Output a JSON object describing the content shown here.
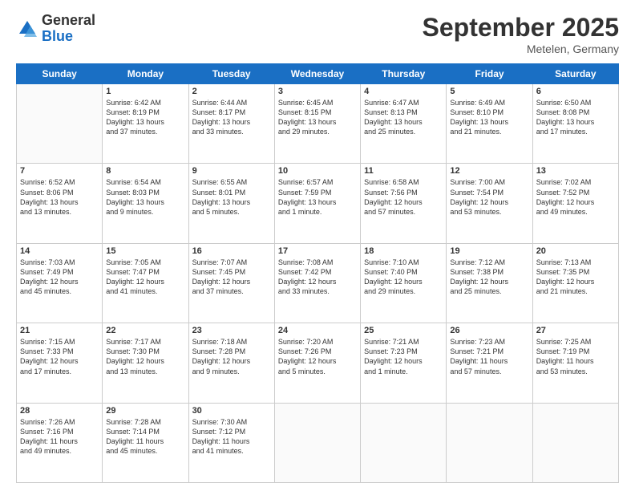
{
  "header": {
    "logo_general": "General",
    "logo_blue": "Blue",
    "month_title": "September 2025",
    "location": "Metelen, Germany"
  },
  "days_of_week": [
    "Sunday",
    "Monday",
    "Tuesday",
    "Wednesday",
    "Thursday",
    "Friday",
    "Saturday"
  ],
  "weeks": [
    [
      {
        "day": "",
        "info": ""
      },
      {
        "day": "1",
        "info": "Sunrise: 6:42 AM\nSunset: 8:19 PM\nDaylight: 13 hours\nand 37 minutes."
      },
      {
        "day": "2",
        "info": "Sunrise: 6:44 AM\nSunset: 8:17 PM\nDaylight: 13 hours\nand 33 minutes."
      },
      {
        "day": "3",
        "info": "Sunrise: 6:45 AM\nSunset: 8:15 PM\nDaylight: 13 hours\nand 29 minutes."
      },
      {
        "day": "4",
        "info": "Sunrise: 6:47 AM\nSunset: 8:13 PM\nDaylight: 13 hours\nand 25 minutes."
      },
      {
        "day": "5",
        "info": "Sunrise: 6:49 AM\nSunset: 8:10 PM\nDaylight: 13 hours\nand 21 minutes."
      },
      {
        "day": "6",
        "info": "Sunrise: 6:50 AM\nSunset: 8:08 PM\nDaylight: 13 hours\nand 17 minutes."
      }
    ],
    [
      {
        "day": "7",
        "info": "Sunrise: 6:52 AM\nSunset: 8:06 PM\nDaylight: 13 hours\nand 13 minutes."
      },
      {
        "day": "8",
        "info": "Sunrise: 6:54 AM\nSunset: 8:03 PM\nDaylight: 13 hours\nand 9 minutes."
      },
      {
        "day": "9",
        "info": "Sunrise: 6:55 AM\nSunset: 8:01 PM\nDaylight: 13 hours\nand 5 minutes."
      },
      {
        "day": "10",
        "info": "Sunrise: 6:57 AM\nSunset: 7:59 PM\nDaylight: 13 hours\nand 1 minute."
      },
      {
        "day": "11",
        "info": "Sunrise: 6:58 AM\nSunset: 7:56 PM\nDaylight: 12 hours\nand 57 minutes."
      },
      {
        "day": "12",
        "info": "Sunrise: 7:00 AM\nSunset: 7:54 PM\nDaylight: 12 hours\nand 53 minutes."
      },
      {
        "day": "13",
        "info": "Sunrise: 7:02 AM\nSunset: 7:52 PM\nDaylight: 12 hours\nand 49 minutes."
      }
    ],
    [
      {
        "day": "14",
        "info": "Sunrise: 7:03 AM\nSunset: 7:49 PM\nDaylight: 12 hours\nand 45 minutes."
      },
      {
        "day": "15",
        "info": "Sunrise: 7:05 AM\nSunset: 7:47 PM\nDaylight: 12 hours\nand 41 minutes."
      },
      {
        "day": "16",
        "info": "Sunrise: 7:07 AM\nSunset: 7:45 PM\nDaylight: 12 hours\nand 37 minutes."
      },
      {
        "day": "17",
        "info": "Sunrise: 7:08 AM\nSunset: 7:42 PM\nDaylight: 12 hours\nand 33 minutes."
      },
      {
        "day": "18",
        "info": "Sunrise: 7:10 AM\nSunset: 7:40 PM\nDaylight: 12 hours\nand 29 minutes."
      },
      {
        "day": "19",
        "info": "Sunrise: 7:12 AM\nSunset: 7:38 PM\nDaylight: 12 hours\nand 25 minutes."
      },
      {
        "day": "20",
        "info": "Sunrise: 7:13 AM\nSunset: 7:35 PM\nDaylight: 12 hours\nand 21 minutes."
      }
    ],
    [
      {
        "day": "21",
        "info": "Sunrise: 7:15 AM\nSunset: 7:33 PM\nDaylight: 12 hours\nand 17 minutes."
      },
      {
        "day": "22",
        "info": "Sunrise: 7:17 AM\nSunset: 7:30 PM\nDaylight: 12 hours\nand 13 minutes."
      },
      {
        "day": "23",
        "info": "Sunrise: 7:18 AM\nSunset: 7:28 PM\nDaylight: 12 hours\nand 9 minutes."
      },
      {
        "day": "24",
        "info": "Sunrise: 7:20 AM\nSunset: 7:26 PM\nDaylight: 12 hours\nand 5 minutes."
      },
      {
        "day": "25",
        "info": "Sunrise: 7:21 AM\nSunset: 7:23 PM\nDaylight: 12 hours\nand 1 minute."
      },
      {
        "day": "26",
        "info": "Sunrise: 7:23 AM\nSunset: 7:21 PM\nDaylight: 11 hours\nand 57 minutes."
      },
      {
        "day": "27",
        "info": "Sunrise: 7:25 AM\nSunset: 7:19 PM\nDaylight: 11 hours\nand 53 minutes."
      }
    ],
    [
      {
        "day": "28",
        "info": "Sunrise: 7:26 AM\nSunset: 7:16 PM\nDaylight: 11 hours\nand 49 minutes."
      },
      {
        "day": "29",
        "info": "Sunrise: 7:28 AM\nSunset: 7:14 PM\nDaylight: 11 hours\nand 45 minutes."
      },
      {
        "day": "30",
        "info": "Sunrise: 7:30 AM\nSunset: 7:12 PM\nDaylight: 11 hours\nand 41 minutes."
      },
      {
        "day": "",
        "info": ""
      },
      {
        "day": "",
        "info": ""
      },
      {
        "day": "",
        "info": ""
      },
      {
        "day": "",
        "info": ""
      }
    ]
  ]
}
